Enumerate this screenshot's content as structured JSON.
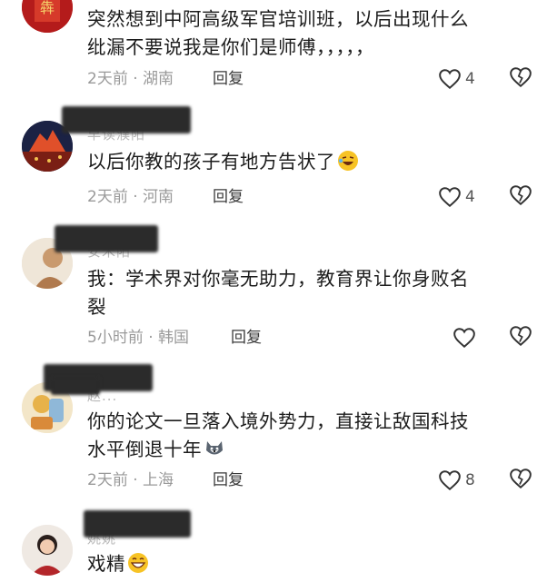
{
  "comments": [
    {
      "text": "突然想到中阿高级军官培训班，以后出现什么纰漏不要说我是你们是师傅，，，，，",
      "line1": "突然想到中阿高级军官培训班，以后出现什么",
      "line2": "纰漏不要说我是你们是师傅，，，，，",
      "time": "2天前",
      "location": "湖南",
      "reply": "回复",
      "likes": "4",
      "avatar_icon": "red-spring-festival-avatar"
    },
    {
      "username": "早读濮阳",
      "line1": "以后你教的孩子有地方告状了",
      "emoji": "rolling-laughing-emoji",
      "time": "2天前",
      "location": "河南",
      "reply": "回复",
      "likes": "4",
      "avatar_icon": "city-night-avatar"
    },
    {
      "username": "安禾阳",
      "line1": "我：学术界对你毫无助力，教育界让你身败名",
      "line2": "裂",
      "time": "5小时前",
      "location": "韩国",
      "reply": "回复",
      "likes": "",
      "avatar_icon": "portrait-avatar"
    },
    {
      "username": "赵...",
      "line1": "你的论文一旦落入境外势力，直接让敌国科技",
      "line2": "水平倒退十年",
      "emoji": "husky-dog-emoji",
      "time": "2天前",
      "location": "上海",
      "reply": "回复",
      "likes": "8",
      "avatar_icon": "toy-figure-avatar"
    },
    {
      "username": "姚姚",
      "line1": "戏精",
      "emoji": "grinning-emoji",
      "avatar_icon": "woman-portrait-avatar"
    }
  ],
  "colors": {
    "text": "#1c1c1c",
    "meta": "#9a9a9a",
    "redact": "#2b2b2b"
  }
}
